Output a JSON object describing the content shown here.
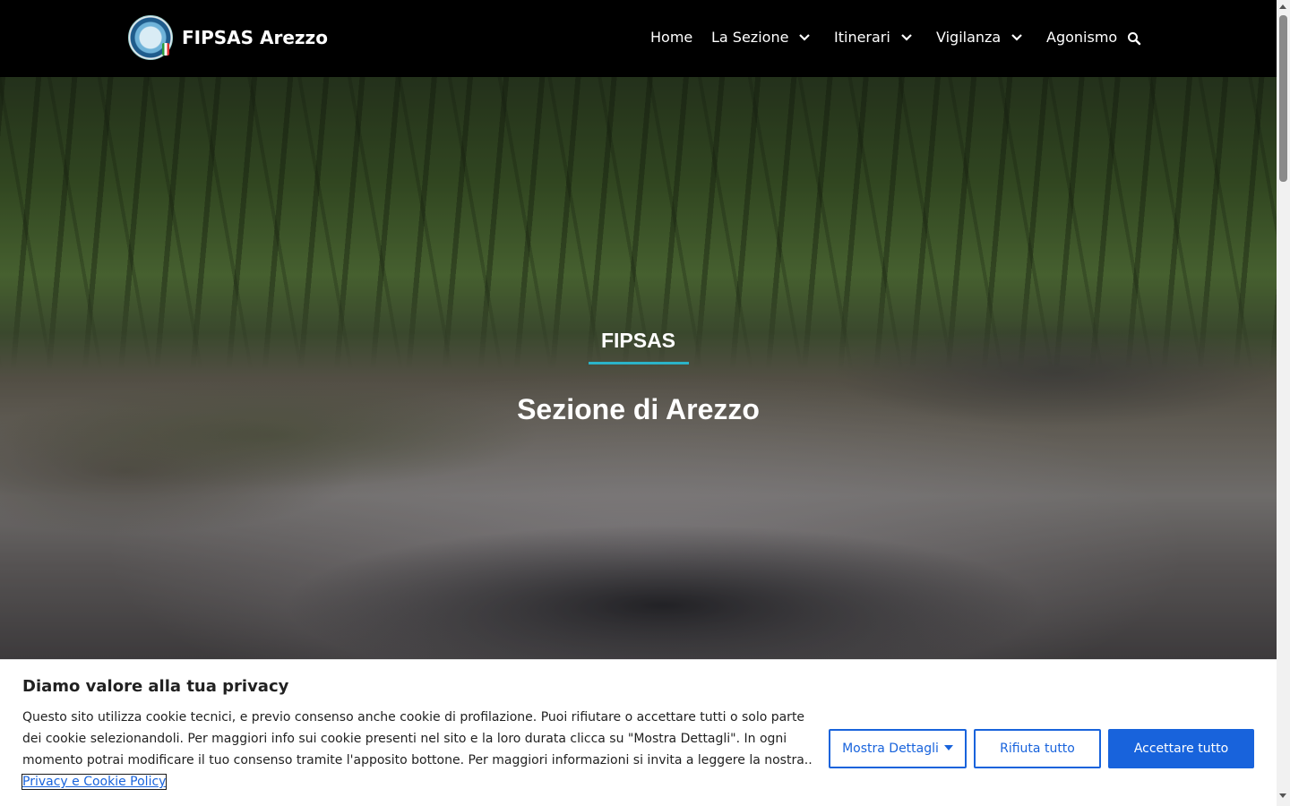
{
  "header": {
    "site_title": "FIPSAS Arezzo",
    "nav": [
      {
        "label": "Home"
      },
      {
        "label": "La Sezione"
      },
      {
        "label": "Itinerari"
      },
      {
        "label": "Vigilanza"
      },
      {
        "label": "Agonismo"
      }
    ],
    "icons": {
      "logo": "fipsas-logo",
      "search": "search-icon",
      "dropdown": "chevron-down-icon"
    }
  },
  "hero": {
    "kicker": "FIPSAS",
    "title": "Sezione di Arezzo",
    "accent_color": "#2bb3c8"
  },
  "cookie_banner": {
    "title": "Diamo valore alla tua privacy",
    "text": "Questo sito utilizza cookie tecnici, e previo consenso anche cookie di profilazione. Puoi rifiutare o accettare tutti o solo parte dei cookie selezionandoli. Per maggiori info sui cookie presenti nel sito e la loro durata clicca su \"Mostra Dettagli\". In ogni momento potrai modificare il tuo consenso tramite l'apposito bottone. Per maggiori informazioni si invita a leggere la nostra.. ",
    "link_text": "Privacy e Cookie Policy",
    "buttons": {
      "details": "Mostra Dettagli",
      "reject": "Rifiuta tutto",
      "accept": "Accettare tutto"
    },
    "accent_color": "#1863dc"
  }
}
